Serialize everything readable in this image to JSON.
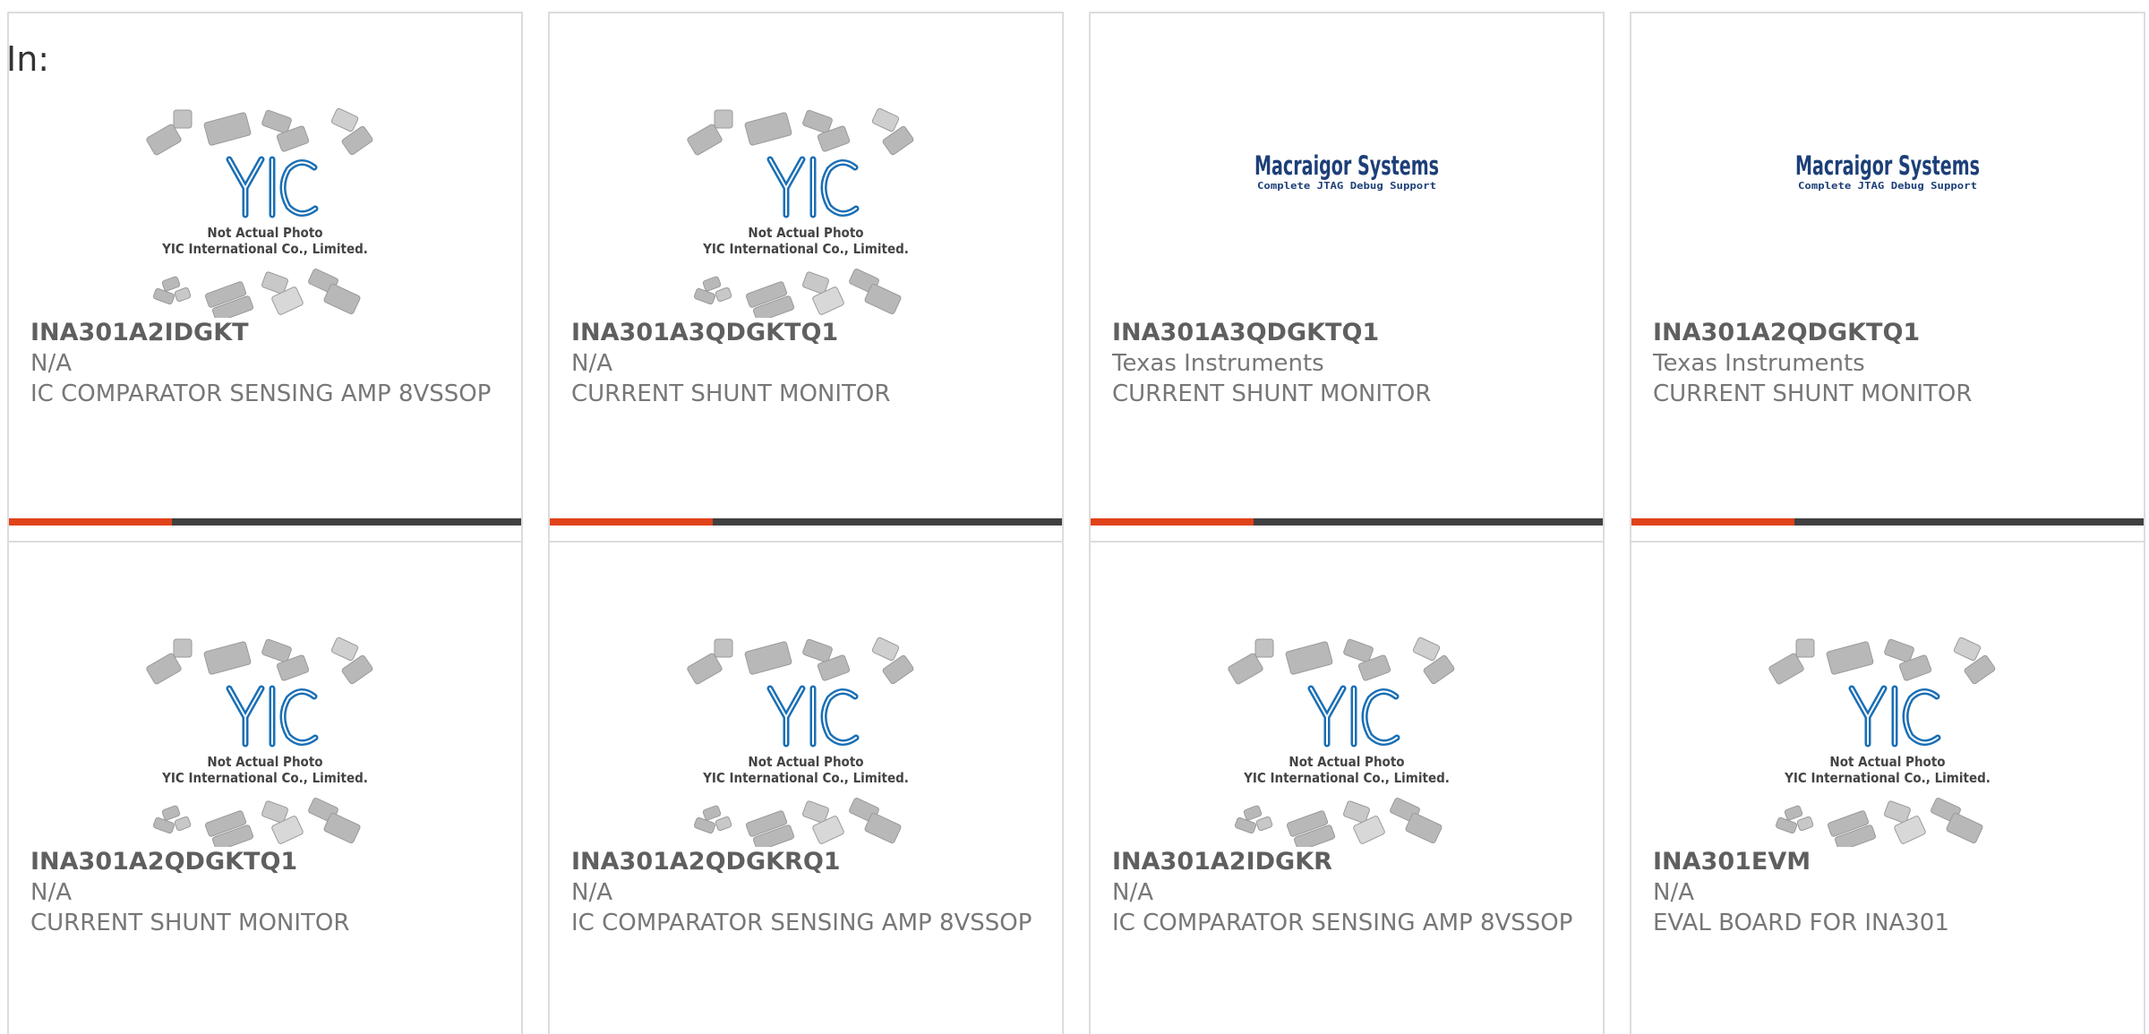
{
  "filter_label": "In:",
  "colors": {
    "accent": "#e0421a",
    "bar": "#404040",
    "yic_blue": "#1a6fb5",
    "macraigor_blue": "#1d3f78"
  },
  "cards": [
    {
      "part": "INA301A2IDGKT",
      "manufacturer": "N/A",
      "description": "IC COMPARATOR SENSING AMP 8VSSOP",
      "image": {
        "type": "yic",
        "caption1": "Not Actual Photo",
        "caption2": "YIC International Co., Limited."
      }
    },
    {
      "part": "INA301A3QDGKTQ1",
      "manufacturer": "N/A",
      "description": "CURRENT SHUNT MONITOR",
      "image": {
        "type": "yic",
        "caption1": "Not Actual Photo",
        "caption2": "YIC International Co., Limited."
      }
    },
    {
      "part": "INA301A3QDGKTQ1",
      "manufacturer": "Texas Instruments",
      "description": "CURRENT SHUNT MONITOR",
      "image": {
        "type": "macraigor",
        "brand": "Macraigor Systems",
        "tagline": "Complete JTAG Debug Support"
      }
    },
    {
      "part": "INA301A2QDGKTQ1",
      "manufacturer": "Texas Instruments",
      "description": "CURRENT SHUNT MONITOR",
      "image": {
        "type": "macraigor",
        "brand": "Macraigor Systems",
        "tagline": "Complete JTAG Debug Support"
      }
    },
    {
      "part": "INA301A2QDGKTQ1",
      "manufacturer": "N/A",
      "description": "CURRENT SHUNT MONITOR",
      "image": {
        "type": "yic",
        "caption1": "Not Actual Photo",
        "caption2": "YIC International Co., Limited."
      }
    },
    {
      "part": "INA301A2QDGKRQ1",
      "manufacturer": "N/A",
      "description": "IC COMPARATOR SENSING AMP 8VSSOP",
      "image": {
        "type": "yic",
        "caption1": "Not Actual Photo",
        "caption2": "YIC International Co., Limited."
      }
    },
    {
      "part": "INA301A2IDGKR",
      "manufacturer": "N/A",
      "description": "IC COMPARATOR SENSING AMP 8VSSOP",
      "image": {
        "type": "yic",
        "caption1": "Not Actual Photo",
        "caption2": "YIC International Co., Limited."
      }
    },
    {
      "part": "INA301EVM",
      "manufacturer": "N/A",
      "description": "EVAL BOARD FOR INA301",
      "image": {
        "type": "yic",
        "caption1": "Not Actual Photo",
        "caption2": "YIC International Co., Limited."
      }
    }
  ]
}
